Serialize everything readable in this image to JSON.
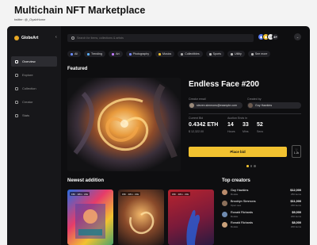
{
  "header": {
    "title": "Multichain NFT Marketplace",
    "twitter": "twitter: @_OyabHome"
  },
  "brand": {
    "name": "GlobeArt",
    "accent": "#f2c230"
  },
  "sidebar": {
    "items": [
      {
        "label": "Overview",
        "icon": "grid-icon",
        "active": true
      },
      {
        "label": "Explore",
        "icon": "compass-icon"
      },
      {
        "label": "Collection",
        "icon": "folder-icon"
      },
      {
        "label": "Creator",
        "icon": "user-icon"
      },
      {
        "label": "Stats",
        "icon": "chart-icon"
      }
    ]
  },
  "search": {
    "placeholder": "Search for items, collections & artists"
  },
  "wallet": {
    "count": "4+"
  },
  "categories": [
    {
      "label": "All",
      "color": "#6a8cff"
    },
    {
      "label": "Trending",
      "color": "#5ab0ff"
    },
    {
      "label": "Art",
      "color": "#c07aff"
    },
    {
      "label": "Photography",
      "color": "#7a8aff"
    },
    {
      "label": "Musics",
      "color": "#f2c230"
    },
    {
      "label": "Collectibles",
      "color": "#aaaaaa"
    },
    {
      "label": "Sports",
      "color": "#bbbbbb"
    },
    {
      "label": "Utility",
      "color": "#bbbbbb"
    },
    {
      "label": "See more",
      "color": "#bbbbbb"
    }
  ],
  "featured": {
    "section_title": "Featured",
    "name": "Endless Face #200",
    "creator_email_label": "Creator email",
    "creator_email": "steven.simmons@example.com",
    "created_by_label": "Created by",
    "created_by": "Guy Hawkins",
    "current_bid_label": "Current Bid",
    "current_bid": "0.4342 ETH",
    "current_bid_usd": "$ 12,322.00",
    "auction_label": "Auction Ends in",
    "hours": "14",
    "hours_label": "Hours",
    "mins": "33",
    "mins_label": "Mins",
    "secs": "52",
    "secs_label": "Secs",
    "place_bid": "Place bid",
    "likes": "1.2k"
  },
  "newest": {
    "section_title": "Newest addition",
    "items": [
      {
        "tag": "15h · 18m · 23s"
      },
      {
        "tag": "15h · 18m · 23s"
      },
      {
        "tag": "15h · 18m · 23s"
      }
    ]
  },
  "creators": {
    "section_title": "Top creators",
    "list": [
      {
        "name": "Guy Hawkins",
        "role": "Rookie",
        "amount": "$12,000",
        "items": "250 items",
        "avatar_color": "#b98b6b"
      },
      {
        "name": "Brooklyn Simmons",
        "role": "Open sea",
        "amount": "$11,000",
        "items": "230 items",
        "avatar_color": "#8b6f5a"
      },
      {
        "name": "Ronald Richards",
        "role": "Rookie",
        "amount": "$9,000",
        "items": "200 items",
        "avatar_color": "#6f8bb0"
      },
      {
        "name": "Ronald Richards",
        "role": "Rookie",
        "amount": "$8,000",
        "items": "200 items",
        "avatar_color": "#c9a07a"
      }
    ]
  }
}
